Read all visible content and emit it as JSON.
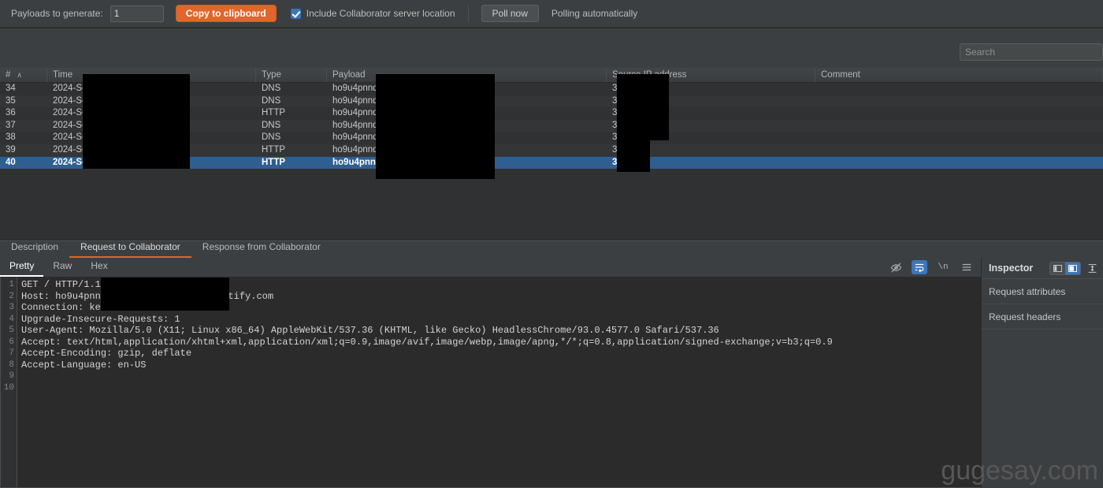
{
  "toolbar": {
    "payloads_label": "Payloads to generate:",
    "payloads_value": "1",
    "copy_button": "Copy to clipboard",
    "include_location_label": "Include Collaborator server location",
    "poll_now_button": "Poll now",
    "polling_status": "Polling automatically"
  },
  "search": {
    "placeholder": "Search",
    "value": ""
  },
  "table": {
    "columns": [
      {
        "key": "num",
        "label": "#",
        "sorted": "asc",
        "sort_glyph": "∧"
      },
      {
        "key": "time",
        "label": "Time"
      },
      {
        "key": "type",
        "label": "Type"
      },
      {
        "key": "payload",
        "label": "Payload"
      },
      {
        "key": "source",
        "label": "Source IP address"
      },
      {
        "key": "comment",
        "label": "Comment"
      }
    ],
    "rows": [
      {
        "num": "34",
        "time": "2024-Se",
        "type": "DNS",
        "payload": "ho9u4pnnds",
        "source": "3.",
        "comment": "",
        "selected": false
      },
      {
        "num": "35",
        "time": "2024-Se",
        "type": "DNS",
        "payload": "ho9u4pnnds",
        "source": "3.",
        "comment": "",
        "selected": false
      },
      {
        "num": "36",
        "time": "2024-Se",
        "type": "HTTP",
        "payload": "ho9u4pnnds",
        "source": "34",
        "comment": "",
        "selected": false
      },
      {
        "num": "37",
        "time": "2024-Se",
        "type": "DNS",
        "payload": "ho9u4pnnds",
        "source": "3.",
        "comment": "",
        "selected": false
      },
      {
        "num": "38",
        "time": "2024-Se",
        "type": "DNS",
        "payload": "ho9u4pnnds",
        "source": "3.",
        "comment": "",
        "selected": false
      },
      {
        "num": "39",
        "time": "2024-Se",
        "type": "HTTP",
        "payload": "ho9u4pnnds",
        "source": "3",
        "comment": "",
        "selected": false
      },
      {
        "num": "40",
        "time": "2024-Se",
        "type": "HTTP",
        "payload": "ho9u4pnnds",
        "source": "3",
        "comment": "",
        "selected": true
      }
    ]
  },
  "lower_tabs": [
    {
      "label": "Description",
      "active": false
    },
    {
      "label": "Request to Collaborator",
      "active": true
    },
    {
      "label": "Response from Collaborator",
      "active": false
    }
  ],
  "editor": {
    "tabs": [
      {
        "label": "Pretty",
        "active": true
      },
      {
        "label": "Raw",
        "active": false
      },
      {
        "label": "Hex",
        "active": false
      }
    ],
    "icons": [
      {
        "name": "eye-off-icon",
        "active": false
      },
      {
        "name": "word-wrap-icon",
        "active": true
      },
      {
        "name": "newline-icon",
        "active": false,
        "text": "\\n"
      },
      {
        "name": "menu-icon",
        "active": false
      }
    ],
    "line_numbers": [
      "1",
      "2",
      "3",
      "4",
      "5",
      "6",
      "7",
      "8",
      "9",
      "10"
    ],
    "lines": [
      "GET / HTTP/1.1",
      "Host: ho9u4pnnd",
      "Connection: kee",
      "Upgrade-Insecure-Requests: 1",
      "User-Agent: Mozilla/5.0 (X11; Linux x86_64) AppleWebKit/537.36 (KHTML, like Gecko) HeadlessChrome/93.0.4577.0 Safari/537.36",
      "Accept: text/html,application/xhtml+xml,application/xml;q=0.9,image/avif,image/webp,image/apng,*/*;q=0.8,application/signed-exchange;v=b3;q=0.9",
      "Accept-Encoding: gzip, deflate",
      "Accept-Language: en-US",
      "",
      ""
    ],
    "host_suffix": "astify.com"
  },
  "inspector": {
    "title": "Inspector",
    "layout_buttons": [
      {
        "name": "layout-left-icon",
        "active": false
      },
      {
        "name": "layout-right-icon",
        "active": true
      }
    ],
    "collapse_icon": "collapse-icon",
    "sections": [
      {
        "label": "Request attributes"
      },
      {
        "label": "Request headers"
      }
    ]
  },
  "watermark": "gugesay.com",
  "colors": {
    "accent_orange": "#e0662b",
    "selection_blue": "#2f5f91",
    "toggle_blue": "#3c76ba",
    "panel_bg": "#3c3f41",
    "editor_bg": "#2b2b2b",
    "table_bg": "#2f3133"
  }
}
